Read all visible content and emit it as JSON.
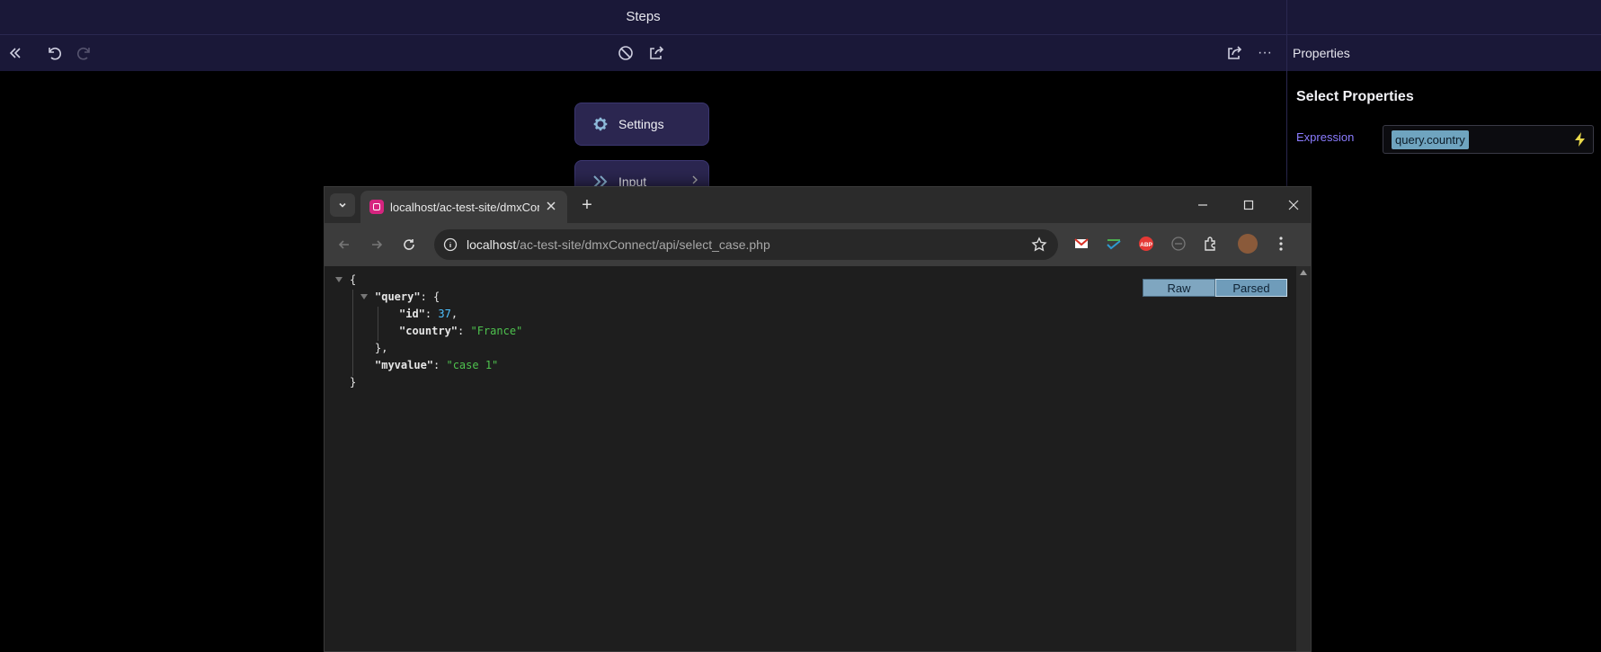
{
  "app": {
    "steps_title": "Steps",
    "properties_label": "Properties"
  },
  "toolbar": {
    "collapse_icon": "double-chevron-left",
    "undo_icon": "undo",
    "redo_icon": "redo",
    "disable_icon": "block",
    "export_icon": "share-out",
    "share_icon": "share",
    "more_label": "···"
  },
  "steps": [
    {
      "label": "Settings",
      "icon": "gear"
    },
    {
      "label": "Input",
      "icon": "double-chevron-right"
    }
  ],
  "properties": {
    "section_title": "Select Properties",
    "expression_label": "Expression",
    "expression_value": "query.country"
  },
  "browser": {
    "tab_title": "localhost/ac-test-site/dmxConnect/api/select_case.php",
    "url_host": "localhost",
    "url_path": "/ac-test-site/dmxConnect/api/select_case.php",
    "new_tab_label": "+",
    "json_view": {
      "raw_label": "Raw",
      "parsed_label": "Parsed",
      "open_brace": "{",
      "close_brace": "}",
      "query_key": "\"query\"",
      "id_key": "\"id\"",
      "id_value": "37",
      "country_key": "\"country\"",
      "country_value": "\"France\"",
      "query_close": "},",
      "myvalue_key": "\"myvalue\"",
      "myvalue_value": "\"case 1\""
    }
  }
}
